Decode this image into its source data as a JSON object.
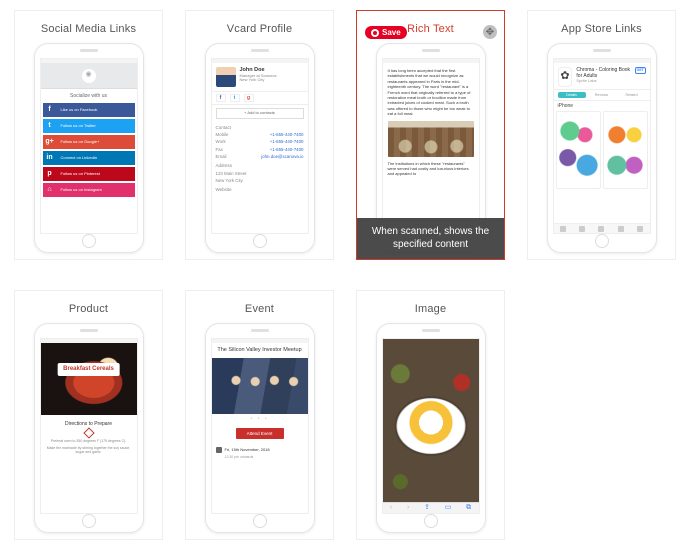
{
  "cards": {
    "social": {
      "title": "Social Media Links"
    },
    "vcard": {
      "title": "Vcard Profile"
    },
    "richtext": {
      "title": "Rich Text",
      "caption": "When scanned, shows the specified content",
      "save": "Save"
    },
    "appstore": {
      "title": "App Store Links"
    },
    "product": {
      "title": "Product"
    },
    "event": {
      "title": "Event"
    },
    "image": {
      "title": "Image"
    }
  },
  "social": {
    "heading": "Socialize with us",
    "items": [
      {
        "label": "Like us on Facebook"
      },
      {
        "label": "Follow us on Twitter"
      },
      {
        "label": "Follow us on Google+"
      },
      {
        "label": "Connect on LinkedIn"
      },
      {
        "label": "Follow us on Pinterest"
      },
      {
        "label": "Follow us on Instagram"
      }
    ]
  },
  "vcard": {
    "name": "John Doe",
    "role": "Manager at Scanova",
    "city": "New York City",
    "add": "+ Add to contacts",
    "contact_h": "Contact",
    "rows": [
      {
        "l": "Mobile",
        "v": "+1-655-440-7400"
      },
      {
        "l": "Work",
        "v": "+1-655-440-7400"
      },
      {
        "l": "Fax",
        "v": "+1-655-440-7400"
      },
      {
        "l": "Email",
        "v": "john.doe@scanova.io"
      }
    ],
    "address_h": "Address",
    "address1": "123 Main Street",
    "address2": "New York City",
    "website_h": "Website"
  },
  "richtext": {
    "p1": "It has long been accepted that the first establishments that we would recognize as restaurants appeared in Paris in the mid-eighteenth century. The word \"restaurant\" is a French word that originally referred to a type of restorative meat broth or bouillon made from extracted juices of cooked meat. Such a broth was offered to those who might be too weak to eat a full meal.",
    "p2": "The institutions in which these \"restaurants\" were served had costly and luxurious interiors and appealed to"
  },
  "appstore": {
    "name": "Chroma - Coloring Book for Adults",
    "dev": "Sprite Labs",
    "get": "GET",
    "tabs": [
      "Details",
      "Reviews",
      "Related"
    ],
    "section": "iPhone"
  },
  "product": {
    "name": "Breakfast Cereals",
    "h": "Directions to Prepare",
    "p1": "Preheat oven to 350 degrees F (175 degrees C).",
    "p2": "Make the marinade by stirring together the soy sauce, sugar and garlic."
  },
  "event": {
    "name": "The Silicon Valley Investor Meetup",
    "btn": "Attend Event",
    "date": "Fri, 15th November, 2018",
    "time": "12:30 pm onwards"
  }
}
